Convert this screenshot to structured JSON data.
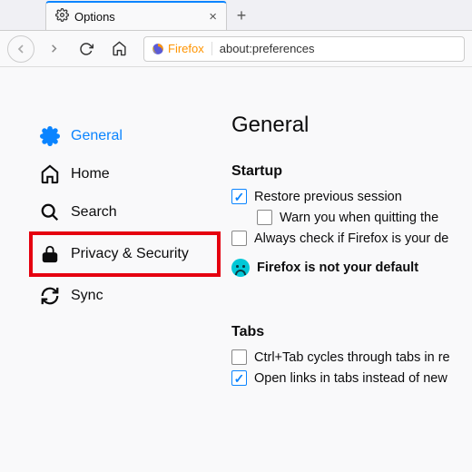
{
  "tab": {
    "title": "Options"
  },
  "urlbar": {
    "identity_label": "Firefox",
    "url": "about:preferences"
  },
  "sidebar": {
    "items": [
      {
        "label": "General"
      },
      {
        "label": "Home"
      },
      {
        "label": "Search"
      },
      {
        "label": "Privacy & Security"
      },
      {
        "label": "Sync"
      }
    ]
  },
  "main": {
    "heading": "General",
    "startup": {
      "title": "Startup",
      "restore": "Restore previous session",
      "warn": "Warn you when quitting the ",
      "always_check": "Always check if Firefox is your de",
      "not_default": "Firefox is not your default "
    },
    "tabs": {
      "title": "Tabs",
      "ctrltab": "Ctrl+Tab cycles through tabs in re",
      "openlinks": "Open links in tabs instead of new"
    }
  }
}
